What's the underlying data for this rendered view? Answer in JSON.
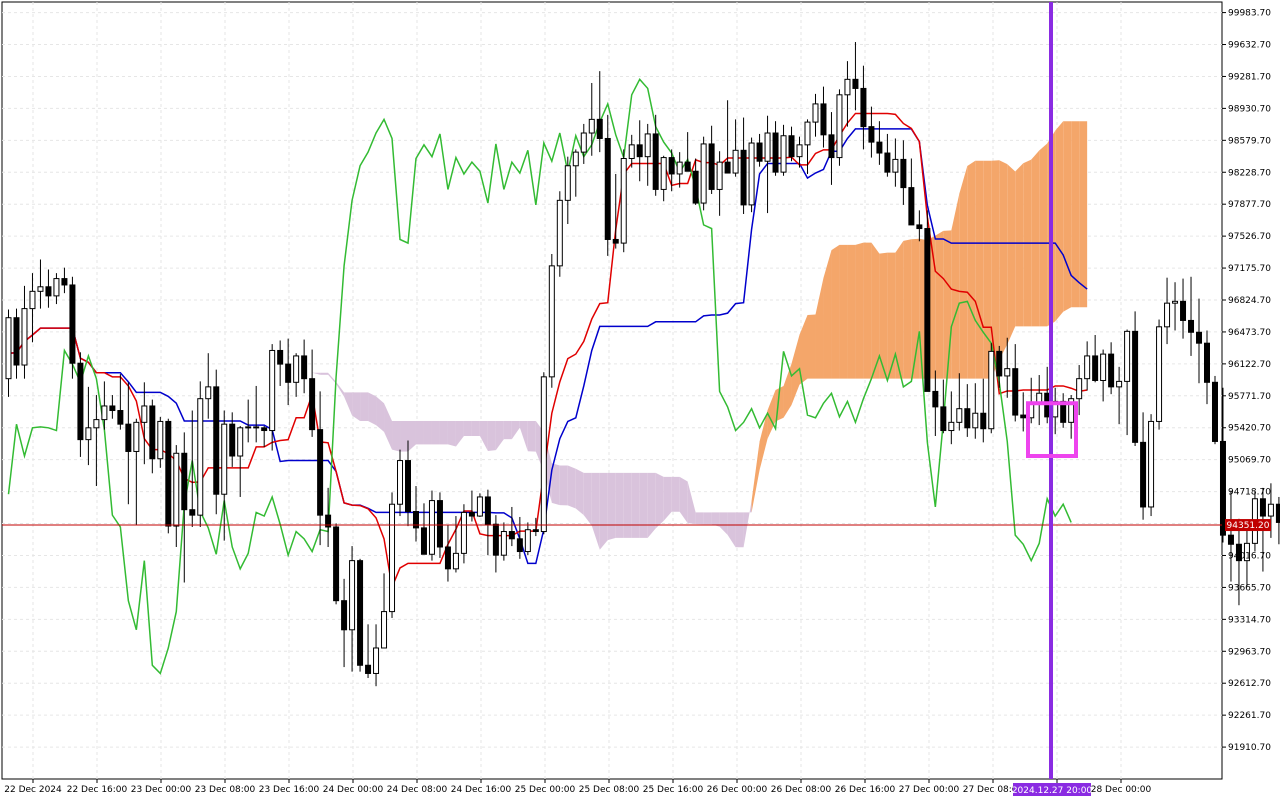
{
  "chart_data": {
    "type": "candlestick",
    "symbol_hint": "",
    "price_axis": {
      "min": 91560.0,
      "max": 100100.0,
      "tick_labels": [
        "99983.70",
        "99632.70",
        "99281.70",
        "98930.70",
        "98579.70",
        "98228.70",
        "97877.70",
        "97526.70",
        "97175.70",
        "96824.70",
        "96473.70",
        "96122.70",
        "95771.70",
        "95420.70",
        "95069.70",
        "94718.70",
        "94367.70",
        "94016.70",
        "93665.70",
        "93314.70",
        "92963.70",
        "92612.70",
        "92261.70",
        "91910.70"
      ]
    },
    "time_axis": {
      "labels": [
        "22 Dec 2024",
        "22 Dec 16:00",
        "23 Dec 00:00",
        "23 Dec 08:00",
        "23 Dec 16:00",
        "24 Dec 00:00",
        "24 Dec 08:00",
        "24 Dec 16:00",
        "25 Dec 00:00",
        "25 Dec 08:00",
        "25 Dec 16:00",
        "26 Dec 00:00",
        "26 Dec 08:00",
        "26 Dec 16:00",
        "27 Dec 00:00",
        "27 Dec 08:00",
        "2024.12.27 20:00",
        "28 Dec 00:00"
      ],
      "highlighted_label": "2024.12.27 20:00",
      "bars_per_label": 8,
      "bar_timeframe": "1h"
    },
    "current_price": {
      "value": 94351.2,
      "label": "94351.20",
      "line_color": "#c00000"
    },
    "colors": {
      "bull_candle": "#ffffff",
      "bear_candle": "#000000",
      "candle_outline": "#000000",
      "tenkan_sen": "#e00000",
      "kijun_sen": "#0000cc",
      "chikou_span": "#33bb33",
      "kumo_bullish": "#f4a66a",
      "kumo_bearish": "#d9c3dc",
      "vertical_marker": "#8a2be2",
      "highlight_box": "#ee44ee",
      "signal_arrow": "#55cc55",
      "grid": "#e6e6e6"
    },
    "grid": true,
    "annotations": [
      {
        "type": "vertical_line",
        "at_label": "2024.12.27 20:00"
      },
      {
        "type": "box",
        "description": "magenta box around kijun/tenkan cross"
      },
      {
        "type": "arrow",
        "direction": "up",
        "color": "signal_arrow"
      }
    ],
    "ohlc": [
      [
        95960,
        96720,
        95760,
        96630
      ],
      [
        96630,
        96730,
        95960,
        96110
      ],
      [
        96110,
        96980,
        95960,
        96730
      ],
      [
        96730,
        97120,
        96360,
        96920
      ],
      [
        96920,
        97270,
        96730,
        96970
      ],
      [
        96970,
        97160,
        96740,
        96870
      ],
      [
        96870,
        97120,
        96780,
        97060
      ],
      [
        97060,
        97180,
        96900,
        96990
      ],
      [
        96990,
        97080,
        95960,
        96130
      ],
      [
        96130,
        96250,
        95100,
        95290
      ],
      [
        95290,
        95870,
        95010,
        95420
      ],
      [
        95420,
        95780,
        94780,
        95510
      ],
      [
        95510,
        95930,
        95400,
        95660
      ],
      [
        95660,
        95780,
        95520,
        95610
      ],
      [
        95610,
        96010,
        95400,
        95460
      ],
      [
        95460,
        95920,
        94580,
        95160
      ],
      [
        95160,
        95520,
        94350,
        95480
      ],
      [
        95480,
        95920,
        95020,
        95660
      ],
      [
        95660,
        95730,
        94920,
        95080
      ],
      [
        95080,
        95540,
        94980,
        95490
      ],
      [
        95490,
        95520,
        94260,
        94340
      ],
      [
        94340,
        95230,
        94110,
        95140
      ],
      [
        95140,
        95370,
        93720,
        94520
      ],
      [
        94520,
        95610,
        94330,
        94460
      ],
      [
        94460,
        95930,
        94330,
        95740
      ],
      [
        95740,
        96240,
        95520,
        95870
      ],
      [
        95870,
        96060,
        94470,
        94690
      ],
      [
        94690,
        95610,
        94180,
        95460
      ],
      [
        95460,
        95590,
        94990,
        95110
      ],
      [
        95110,
        95440,
        94660,
        95420
      ],
      [
        95420,
        95730,
        95260,
        95430
      ],
      [
        95430,
        95880,
        95260,
        95420
      ],
      [
        95420,
        95440,
        95210,
        95390
      ],
      [
        95390,
        96340,
        95170,
        96270
      ],
      [
        96270,
        96380,
        95880,
        96120
      ],
      [
        96120,
        96400,
        95670,
        95920
      ],
      [
        95920,
        96240,
        95760,
        96210
      ],
      [
        96210,
        96390,
        95800,
        95960
      ],
      [
        95960,
        96280,
        95320,
        95400
      ],
      [
        95400,
        95820,
        94130,
        94460
      ],
      [
        94460,
        94760,
        94110,
        94330
      ],
      [
        94330,
        94370,
        93480,
        93520
      ],
      [
        93520,
        93760,
        92790,
        93200
      ],
      [
        93200,
        94120,
        92740,
        93960
      ],
      [
        93960,
        93980,
        92740,
        92810
      ],
      [
        92810,
        93260,
        92670,
        92720
      ],
      [
        92720,
        93260,
        92580,
        93000
      ],
      [
        93000,
        93820,
        93000,
        93400
      ],
      [
        93400,
        94710,
        93330,
        94580
      ],
      [
        94580,
        95180,
        94450,
        95060
      ],
      [
        95060,
        95280,
        94340,
        94500
      ],
      [
        94500,
        94780,
        94170,
        94320
      ],
      [
        94320,
        94590,
        94060,
        94030
      ],
      [
        94030,
        94730,
        93960,
        94620
      ],
      [
        94620,
        94710,
        93990,
        94110
      ],
      [
        94110,
        94350,
        93730,
        93870
      ],
      [
        93870,
        94450,
        93830,
        94040
      ],
      [
        94040,
        94580,
        93930,
        94490
      ],
      [
        94490,
        94730,
        94390,
        94450
      ],
      [
        94450,
        94700,
        94440,
        94660
      ],
      [
        94660,
        94740,
        94020,
        94360
      ],
      [
        94360,
        94460,
        93830,
        94020
      ],
      [
        94020,
        94380,
        93960,
        94280
      ],
      [
        94280,
        94550,
        94120,
        94200
      ],
      [
        94200,
        94440,
        93980,
        94060
      ],
      [
        94060,
        94380,
        94020,
        94300
      ],
      [
        94300,
        94430,
        94230,
        94280
      ],
      [
        94280,
        96030,
        94250,
        95980
      ],
      [
        95980,
        97330,
        95860,
        97200
      ],
      [
        97200,
        98020,
        97080,
        97920
      ],
      [
        97920,
        98400,
        97660,
        98300
      ],
      [
        98300,
        98480,
        97960,
        98450
      ],
      [
        98450,
        98760,
        98320,
        98660
      ],
      [
        98660,
        99210,
        98410,
        98810
      ],
      [
        98810,
        99340,
        98450,
        98600
      ],
      [
        98600,
        98860,
        97310,
        97490
      ],
      [
        97490,
        98210,
        97390,
        97450
      ],
      [
        97450,
        98480,
        97350,
        98380
      ],
      [
        98380,
        98640,
        98280,
        98530
      ],
      [
        98530,
        98800,
        98130,
        98400
      ],
      [
        98400,
        98760,
        98080,
        98650
      ],
      [
        98650,
        98860,
        97970,
        98040
      ],
      [
        98040,
        98410,
        97910,
        98390
      ],
      [
        98390,
        98480,
        98020,
        98210
      ],
      [
        98210,
        98450,
        98060,
        98340
      ],
      [
        98340,
        98670,
        98290,
        98240
      ],
      [
        98240,
        98380,
        97870,
        97890
      ],
      [
        97890,
        98620,
        97810,
        98540
      ],
      [
        98540,
        98740,
        97990,
        98040
      ],
      [
        98040,
        98460,
        97750,
        98340
      ],
      [
        98340,
        99020,
        98260,
        98220
      ],
      [
        98220,
        98810,
        98180,
        98470
      ],
      [
        98470,
        98830,
        97770,
        97870
      ],
      [
        97870,
        98610,
        97790,
        98550
      ],
      [
        98550,
        98650,
        98290,
        98350
      ],
      [
        98350,
        98850,
        97780,
        98660
      ],
      [
        98660,
        98790,
        98190,
        98230
      ],
      [
        98230,
        98750,
        98190,
        98630
      ],
      [
        98630,
        98730,
        98350,
        98400
      ],
      [
        98400,
        98620,
        98280,
        98530
      ],
      [
        98530,
        98810,
        98210,
        98780
      ],
      [
        98780,
        99090,
        98620,
        98980
      ],
      [
        98980,
        99170,
        98500,
        98640
      ],
      [
        98640,
        98890,
        98090,
        98390
      ],
      [
        98390,
        99140,
        98300,
        99080
      ],
      [
        99080,
        99450,
        98730,
        99250
      ],
      [
        99250,
        99660,
        98910,
        99150
      ],
      [
        99150,
        99400,
        98480,
        98730
      ],
      [
        98730,
        98950,
        98390,
        98560
      ],
      [
        98560,
        98790,
        98310,
        98440
      ],
      [
        98440,
        98650,
        98180,
        98230
      ],
      [
        98230,
        98600,
        98070,
        98370
      ],
      [
        98370,
        98580,
        97870,
        98060
      ],
      [
        98060,
        98380,
        97760,
        97650
      ],
      [
        97650,
        97810,
        97470,
        97610
      ],
      [
        97610,
        97810,
        96070,
        95820
      ],
      [
        95820,
        96050,
        95330,
        95650
      ],
      [
        95650,
        95950,
        95360,
        95390
      ],
      [
        95390,
        95820,
        95240,
        95480
      ],
      [
        95480,
        96020,
        95390,
        95630
      ],
      [
        95630,
        95900,
        95320,
        95420
      ],
      [
        95420,
        95910,
        95300,
        95580
      ],
      [
        95580,
        95960,
        95260,
        95410
      ],
      [
        95410,
        96350,
        95360,
        96260
      ],
      [
        96260,
        96320,
        95860,
        95990
      ],
      [
        95990,
        96410,
        95750,
        96070
      ],
      [
        96070,
        96340,
        95490,
        95560
      ],
      [
        95560,
        95810,
        95380,
        95530
      ],
      [
        95530,
        95970,
        95470,
        95690
      ],
      [
        95690,
        96000,
        95450,
        95800
      ],
      [
        95800,
        96090,
        95470,
        95540
      ],
      [
        95540,
        95860,
        95350,
        95710
      ],
      [
        95710,
        95800,
        95420,
        95480
      ],
      [
        95480,
        95780,
        95300,
        95740
      ],
      [
        95740,
        96110,
        95560,
        95960
      ],
      [
        95960,
        96370,
        95830,
        96210
      ],
      [
        96210,
        96440,
        95920,
        95940
      ],
      [
        95940,
        96280,
        95710,
        96230
      ],
      [
        96230,
        96360,
        95790,
        95870
      ],
      [
        95870,
        96090,
        95460,
        95930
      ],
      [
        95930,
        96500,
        95340,
        96480
      ],
      [
        96480,
        96700,
        95220,
        95260
      ],
      [
        95260,
        95590,
        94410,
        94550
      ],
      [
        94550,
        95570,
        94450,
        95490
      ],
      [
        95490,
        96610,
        95400,
        96530
      ],
      [
        96530,
        97070,
        96340,
        96790
      ],
      [
        96790,
        97020,
        96490,
        96810
      ],
      [
        96810,
        97060,
        96400,
        96600
      ],
      [
        96600,
        97080,
        96210,
        96470
      ],
      [
        96470,
        96840,
        95910,
        96350
      ],
      [
        96350,
        96490,
        95680,
        95920
      ],
      [
        95920,
        95990,
        95240,
        95270
      ],
      [
        95270,
        95860,
        94160,
        94240
      ],
      [
        94240,
        94730,
        93730,
        94140
      ],
      [
        94140,
        94420,
        93470,
        93960
      ],
      [
        93960,
        94300,
        93680,
        94150
      ],
      [
        94150,
        94720,
        94060,
        94640
      ],
      [
        94640,
        94760,
        93840,
        94450
      ],
      [
        94450,
        94810,
        94210,
        94580
      ],
      [
        94580,
        94660,
        94140,
        94380
      ]
    ]
  }
}
